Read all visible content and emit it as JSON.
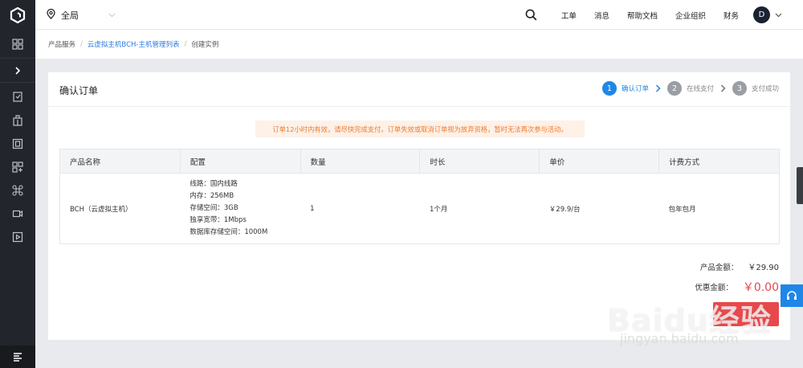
{
  "topbar": {
    "region_label": "全局",
    "nav": [
      "工单",
      "消息",
      "帮助文档",
      "企业组织",
      "财务"
    ],
    "avatar_letter": "D"
  },
  "breadcrumb": [
    "产品服务",
    "云虚拟主机BCH-主机管理列表",
    "创建实例"
  ],
  "card": {
    "title": "确认订单",
    "steps": [
      {
        "num": "1",
        "label": "确认订单",
        "active": true
      },
      {
        "num": "2",
        "label": "在线支付",
        "active": false
      },
      {
        "num": "3",
        "label": "支付成功",
        "active": false
      }
    ],
    "notice": "订单12小时内有效，请尽快完成支付。订单失效或取消订单视为放弃资格，暂时无法再次参与活动。"
  },
  "table": {
    "headers": [
      "产品名称",
      "配置",
      "数量",
      "时长",
      "单价",
      "计费方式"
    ],
    "row": {
      "product": "BCH（云虚拟主机）",
      "config": [
        "线路：国内线路",
        "内存：256MB",
        "存储空间：3GB",
        "独享宽带：1Mbps",
        "数据库存储空间：1000M"
      ],
      "quantity": "1",
      "duration": "1个月",
      "price": "￥29.9/台",
      "billing": "包年包月"
    }
  },
  "summary": {
    "product_amount_label": "产品金额：",
    "product_amount": "￥29.90",
    "discount_label": "优惠金额：",
    "discount": "￥0.00"
  },
  "submit_label": "",
  "watermark": {
    "main": "Baidu经验",
    "sub": "jingyan.baidu.com"
  },
  "colors": {
    "accent": "#1f87e8",
    "danger": "#e8484b",
    "notice_text": "#f07a2d",
    "sidebar": "#22252b"
  },
  "sidebar_icons": [
    "logo-icon",
    "grid-icon",
    "chevron-right-icon",
    "clipboard-icon",
    "building-icon",
    "film-icon",
    "apps-icon",
    "command-icon",
    "camera-icon",
    "play-icon",
    "menu-icon"
  ]
}
